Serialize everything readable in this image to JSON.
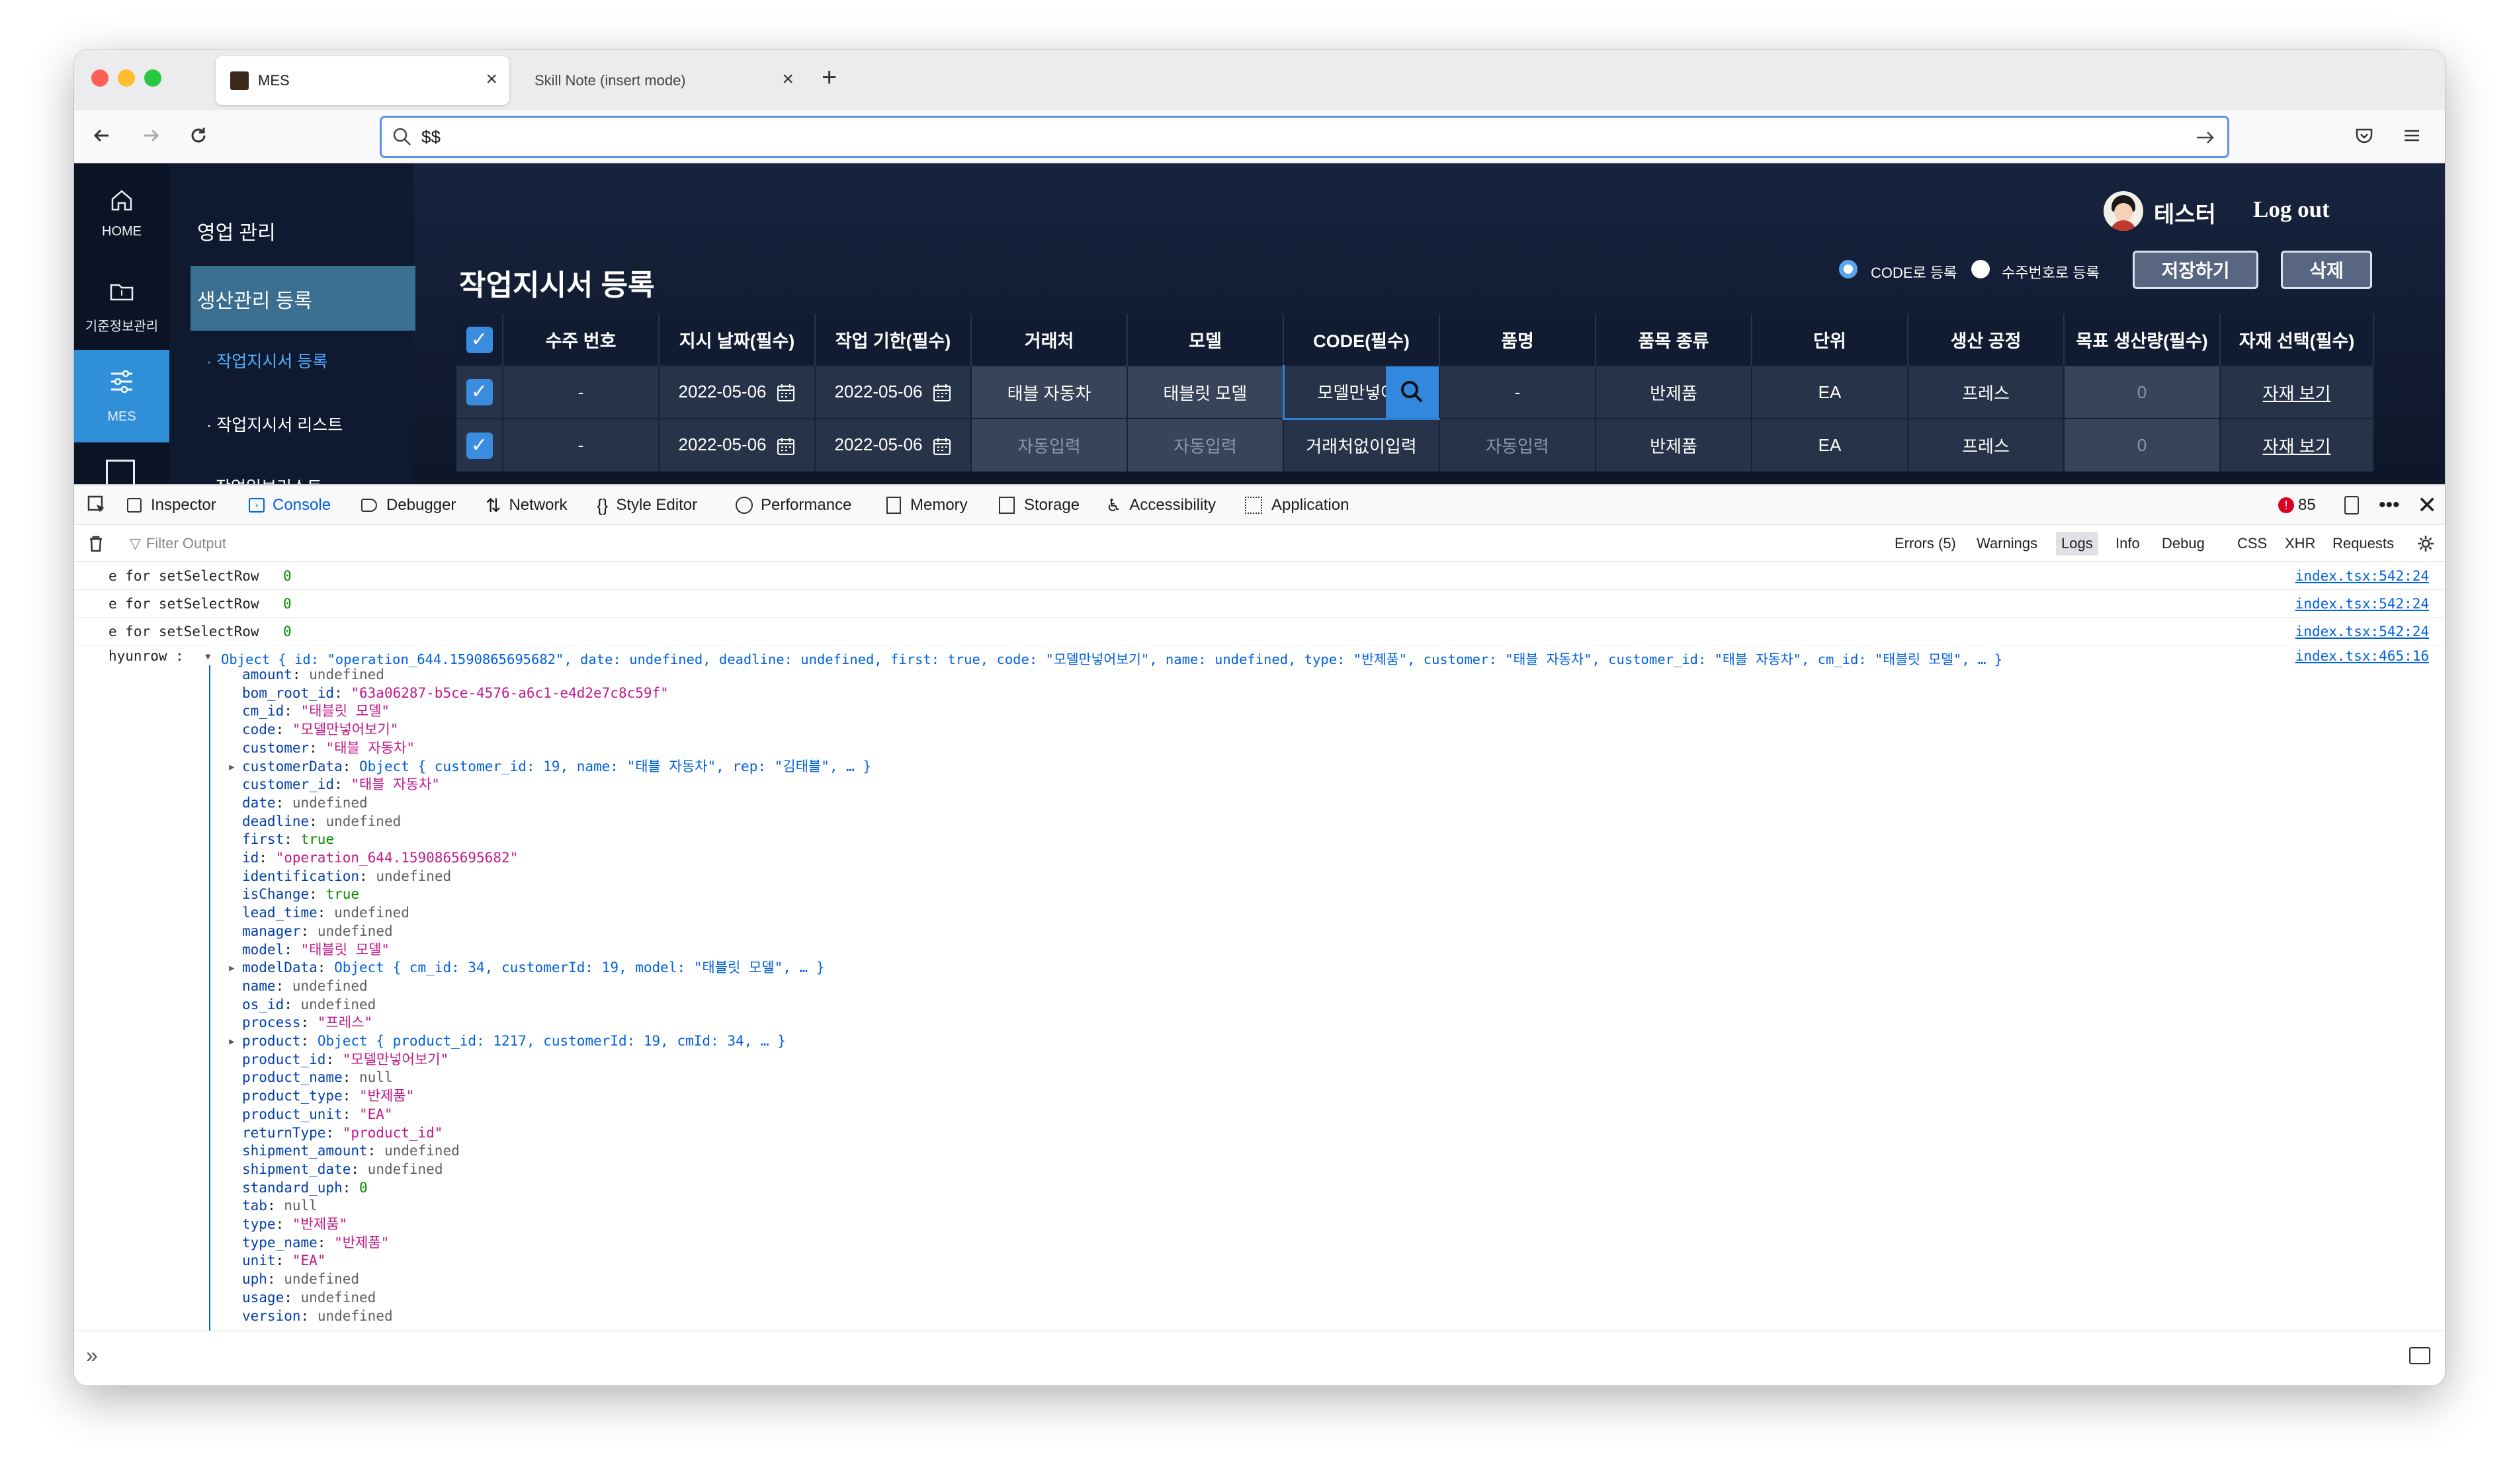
{
  "browser": {
    "tabs": [
      {
        "title": "MES",
        "active": true
      },
      {
        "title": "Skill Note (insert mode)",
        "active": false
      }
    ],
    "url": "$$"
  },
  "app": {
    "user_name": "테스터",
    "logout_label": "Log out",
    "sidebar": [
      {
        "label": "HOME",
        "icon": "home-icon"
      },
      {
        "label": "기준정보관리",
        "icon": "folder-icon"
      },
      {
        "label": "MES",
        "icon": "sliders-icon",
        "active": true
      }
    ],
    "submenu": {
      "section1": "영업 관리",
      "section2": "생산관리 등록",
      "items": [
        "· 작업지시서 등록",
        "· 작업지시서 리스트",
        "작업일보리스트"
      ]
    },
    "page_title": "작업지시서 등록",
    "radio_code": "CODE로 등록",
    "radio_order": "수주번호로 등록",
    "save_label": "저장하기",
    "delete_label": "삭제",
    "table": {
      "headers": [
        "",
        "수주 번호",
        "지시 날짜(필수)",
        "작업 기한(필수)",
        "거래처",
        "모델",
        "CODE(필수)",
        "품명",
        "품목 종류",
        "단위",
        "생산 공정",
        "목표 생산량(필수)",
        "자재 선택(필수)"
      ],
      "rows": [
        {
          "order_no": "-",
          "date": "2022-05-06",
          "deadline": "2022-05-06",
          "customer": "태블 자동차",
          "model": "태블릿 모델",
          "code": "모델만넣어보",
          "name": "-",
          "type": "반제품",
          "unit": "EA",
          "process": "프레스",
          "goal": "0",
          "material": "자재 보기"
        },
        {
          "order_no": "-",
          "date": "2022-05-06",
          "deadline": "2022-05-06",
          "customer": "자동입력",
          "model": "자동입력",
          "code": "거래처없이입력",
          "name": "자동입력",
          "type": "반제품",
          "unit": "EA",
          "process": "프레스",
          "goal": "0",
          "material": "자재 보기"
        }
      ]
    }
  },
  "devtools": {
    "tabs": [
      "Inspector",
      "Console",
      "Debugger",
      "Network",
      "Style Editor",
      "Performance",
      "Memory",
      "Storage",
      "Accessibility",
      "Application"
    ],
    "active_tab": "Console",
    "error_count": "85",
    "filter_placeholder": "Filter Output",
    "filters": [
      "Errors (5)",
      "Warnings",
      "Logs",
      "Info",
      "Debug",
      "CSS",
      "XHR",
      "Requests"
    ],
    "active_filter": "Logs",
    "logs": [
      {
        "text": "e for setSelectRow",
        "value": "0",
        "source": "index.tsx:542:24"
      },
      {
        "text": "e for setSelectRow",
        "value": "0",
        "source": "index.tsx:542:24"
      },
      {
        "text": "e for setSelectRow",
        "value": "0",
        "source": "index.tsx:542:24"
      }
    ],
    "object_log": {
      "label": "hyunrow :",
      "summary": "Object { id: \"operation_644.1590865695682\", date: undefined, deadline: undefined, first: true, code: \"모델만넣어보기\", name: undefined, type: \"반제품\", customer: \"태블 자동차\", customer_id: \"태블 자동차\", cm_id: \"태블릿 모델\", … }",
      "source": "index.tsx:465:16",
      "properties": [
        {
          "key": "amount",
          "value": "undefined",
          "kind": "u"
        },
        {
          "key": "bom_root_id",
          "value": "\"63a06287-b5ce-4576-a6c1-e4d2e7c8c59f\"",
          "kind": "s"
        },
        {
          "key": "cm_id",
          "value": "\"태블릿 모델\"",
          "kind": "s"
        },
        {
          "key": "code",
          "value": "\"모델만넣어보기\"",
          "kind": "s"
        },
        {
          "key": "customer",
          "value": "\"태블 자동차\"",
          "kind": "s"
        },
        {
          "key": "customerData",
          "value": "Object { customer_id: 19, name: \"태블 자동차\", rep: \"김태블\", … }",
          "kind": "o",
          "expandable": true
        },
        {
          "key": "customer_id",
          "value": "\"태블 자동차\"",
          "kind": "s"
        },
        {
          "key": "date",
          "value": "undefined",
          "kind": "u"
        },
        {
          "key": "deadline",
          "value": "undefined",
          "kind": "u"
        },
        {
          "key": "first",
          "value": "true",
          "kind": "bv"
        },
        {
          "key": "id",
          "value": "\"operation_644.1590865695682\"",
          "kind": "s"
        },
        {
          "key": "identification",
          "value": "undefined",
          "kind": "u"
        },
        {
          "key": "isChange",
          "value": "true",
          "kind": "bv"
        },
        {
          "key": "lead_time",
          "value": "undefined",
          "kind": "u"
        },
        {
          "key": "manager",
          "value": "undefined",
          "kind": "u"
        },
        {
          "key": "model",
          "value": "\"태블릿 모델\"",
          "kind": "s"
        },
        {
          "key": "modelData",
          "value": "Object { cm_id: 34, customerId: 19, model: \"태블릿 모델\", … }",
          "kind": "o",
          "expandable": true
        },
        {
          "key": "name",
          "value": "undefined",
          "kind": "u"
        },
        {
          "key": "os_id",
          "value": "undefined",
          "kind": "u"
        },
        {
          "key": "process",
          "value": "\"프레스\"",
          "kind": "s"
        },
        {
          "key": "product",
          "value": "Object { product_id: 1217, customerId: 19, cmId: 34, … }",
          "kind": "o",
          "expandable": true
        },
        {
          "key": "product_id",
          "value": "\"모델만넣어보기\"",
          "kind": "s"
        },
        {
          "key": "product_name",
          "value": "null",
          "kind": "u"
        },
        {
          "key": "product_type",
          "value": "\"반제품\"",
          "kind": "s"
        },
        {
          "key": "product_unit",
          "value": "\"EA\"",
          "kind": "s"
        },
        {
          "key": "returnType",
          "value": "\"product_id\"",
          "kind": "s"
        },
        {
          "key": "shipment_amount",
          "value": "undefined",
          "kind": "u"
        },
        {
          "key": "shipment_date",
          "value": "undefined",
          "kind": "u"
        },
        {
          "key": "standard_uph",
          "value": "0",
          "kind": "n"
        },
        {
          "key": "tab",
          "value": "null",
          "kind": "u"
        },
        {
          "key": "type",
          "value": "\"반제품\"",
          "kind": "s"
        },
        {
          "key": "type_name",
          "value": "\"반제품\"",
          "kind": "s"
        },
        {
          "key": "unit",
          "value": "\"EA\"",
          "kind": "s"
        },
        {
          "key": "uph",
          "value": "undefined",
          "kind": "u"
        },
        {
          "key": "usage",
          "value": "undefined",
          "kind": "u"
        },
        {
          "key": "version",
          "value": "undefined",
          "kind": "u"
        }
      ]
    },
    "prompt_symbol": "»"
  },
  "colors": {
    "accent": "#2f8fd8",
    "app_bg": "#17233f",
    "devtools_active": "#0061e0"
  }
}
